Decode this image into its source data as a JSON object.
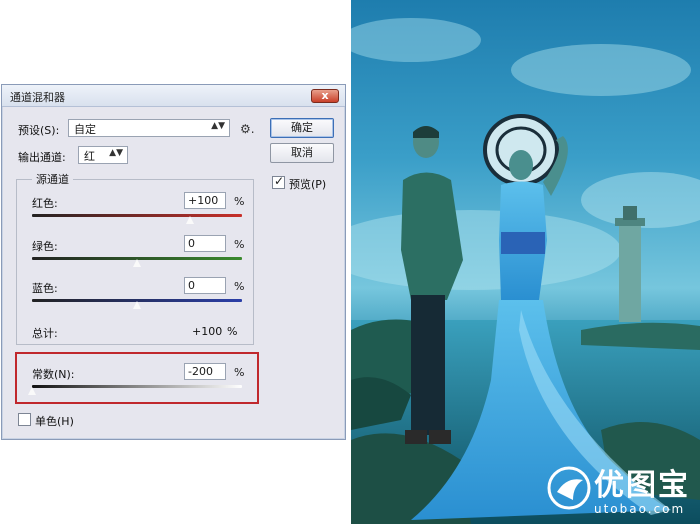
{
  "dialog": {
    "title": "通道混和器",
    "close_label": "x",
    "preset": {
      "label": "预设(S):",
      "value": "自定"
    },
    "output": {
      "label": "输出通道:",
      "value": "红"
    },
    "buttons": {
      "ok": "确定",
      "cancel": "取消"
    },
    "preview": {
      "label": "预览(P)",
      "checked": true
    },
    "source_group": "源通道",
    "channels": [
      {
        "label": "红色:",
        "value": "+100",
        "unit": "%",
        "slider_fraction": 0.75
      },
      {
        "label": "绿色:",
        "value": "0",
        "unit": "%",
        "slider_fraction": 0.5
      },
      {
        "label": "蓝色:",
        "value": "0",
        "unit": "%",
        "slider_fraction": 0.5
      }
    ],
    "total": {
      "label": "总计:",
      "value": "+100",
      "unit": "%"
    },
    "constant": {
      "label": "常数(N):",
      "value": "-200",
      "unit": "%",
      "slider_fraction": 0.0
    },
    "monochrome": {
      "label": "单色(H)",
      "checked": false
    }
  },
  "photo": {
    "watermark_main": "优图宝",
    "watermark_url": "utobao.com"
  },
  "colors": {
    "red_track": "#c8302a",
    "green_track": "#3a8a2e",
    "blue_track": "#2b3fa8",
    "highlight": "#c0282d"
  }
}
